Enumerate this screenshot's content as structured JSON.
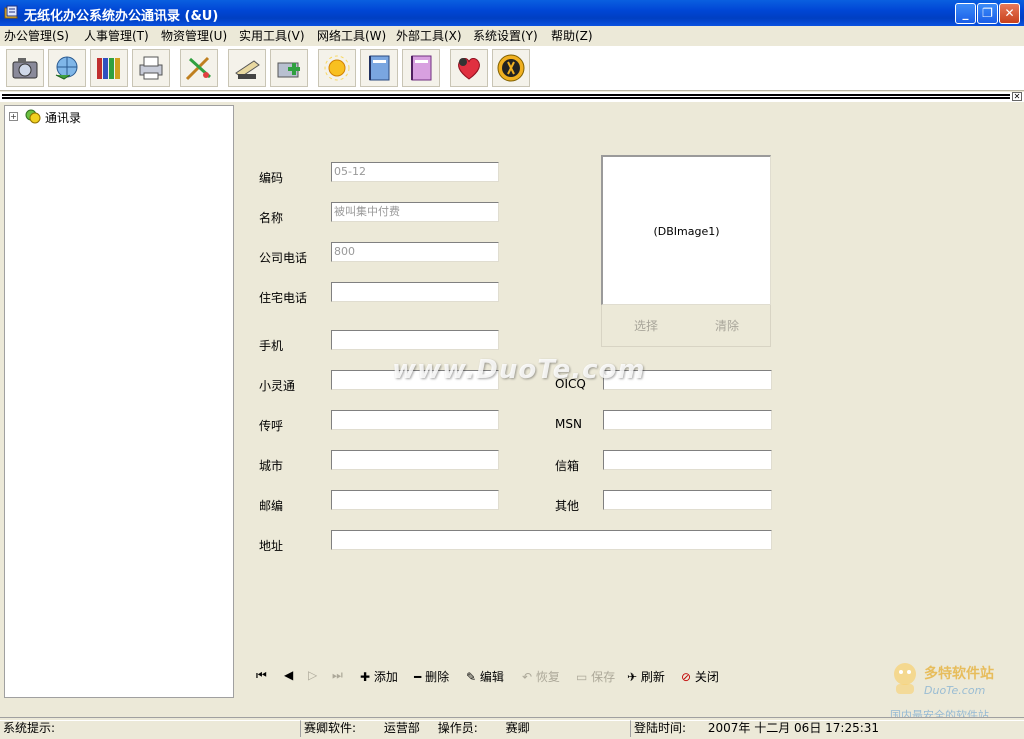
{
  "window": {
    "title": "无纸化办公系统办公通讯录 (&U)"
  },
  "menu": [
    "办公管理(S)",
    "人事管理(T)",
    "物资管理(U)",
    "实用工具(V)",
    "网络工具(W)",
    "外部工具(X)",
    "系统设置(Y)",
    "帮助(Z)"
  ],
  "toolbar": {
    "icons": [
      "camera-icon",
      "network-icon",
      "books-icon",
      "printer-icon",
      "tools-icon",
      "scanner-icon",
      "install-icon",
      "sun-icon",
      "notebook-blue-icon",
      "notebook-pink-icon",
      "heart-icon",
      "exit-icon"
    ]
  },
  "tree": {
    "root": "通讯录"
  },
  "form": {
    "labels": {
      "code": "编码",
      "name": "名称",
      "office_phone": "公司电话",
      "home_phone": "住宅电话",
      "mobile": "手机",
      "phs": "小灵通",
      "pager": "传呼",
      "city": "城市",
      "zip": "邮编",
      "address": "地址",
      "oicq": "OICQ",
      "msn": "MSN",
      "email": "信箱",
      "other": "其他"
    },
    "values": {
      "code": "05-12",
      "name": "被叫集中付费",
      "office_phone": "800"
    },
    "image_caption": "(DBImage1)",
    "image_select": "选择",
    "image_clear": "清除"
  },
  "navigator": {
    "first": "⏮",
    "prev": "◀",
    "next": "▷",
    "last": "⏭",
    "add": "添加",
    "delete": "删除",
    "edit": "编辑",
    "restore": "恢复",
    "save": "保存",
    "refresh": "刷新",
    "close": "关闭"
  },
  "status": {
    "hint_label": "系统提示:",
    "company": "赛卿软件:",
    "dept": "运营部",
    "operator_label": "操作员:",
    "operator": "赛卿",
    "login_label": "登陆时间:",
    "login_time": "2007年 十二月 06日 17:25:31"
  },
  "watermark": "www.DuoTe.com",
  "logo": {
    "brand": "多特软件站",
    "sub": "DuoTe.com",
    "slogan": "国内最安全的软件站"
  },
  "colors": {
    "title_bar": "#0046d5",
    "face": "#ece9d8"
  }
}
